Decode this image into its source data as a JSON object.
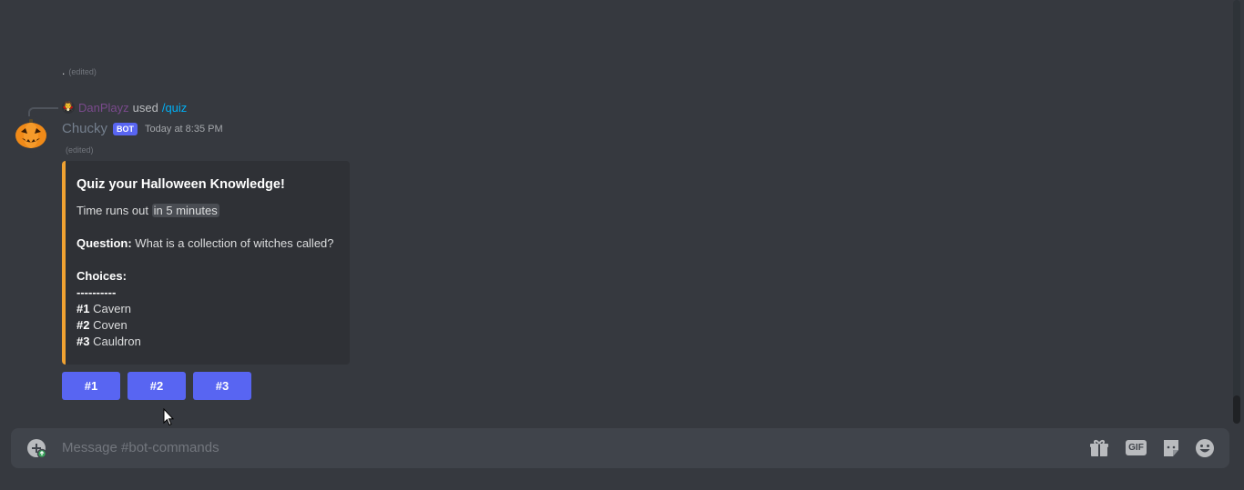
{
  "previous_message": {
    "text": ".",
    "edited": "(edited)"
  },
  "reply": {
    "user": "DanPlayz",
    "verb": "used",
    "command": "/quiz"
  },
  "message": {
    "username": "Chucky",
    "bot_tag": "BOT",
    "timestamp": "Today at 8:35 PM",
    "edited": "(edited)"
  },
  "embed": {
    "accent_color": "#f0a232",
    "title": "Quiz your Halloween Knowledge!",
    "time_prefix": "Time runs out",
    "time_value": "in 5 minutes",
    "question_label": "Question:",
    "question_text": "What is a collection of witches called?",
    "choices_label": "Choices:",
    "divider": "----------",
    "choices": [
      {
        "num": "#1",
        "text": "Cavern"
      },
      {
        "num": "#2",
        "text": "Coven"
      },
      {
        "num": "#3",
        "text": "Cauldron"
      }
    ]
  },
  "buttons": [
    "#1",
    "#2",
    "#3"
  ],
  "composer": {
    "placeholder": "Message #bot-commands",
    "gif_label": "GIF"
  },
  "colors": {
    "background": "#36393f",
    "button": "#5865f2",
    "composer": "#40444b"
  }
}
